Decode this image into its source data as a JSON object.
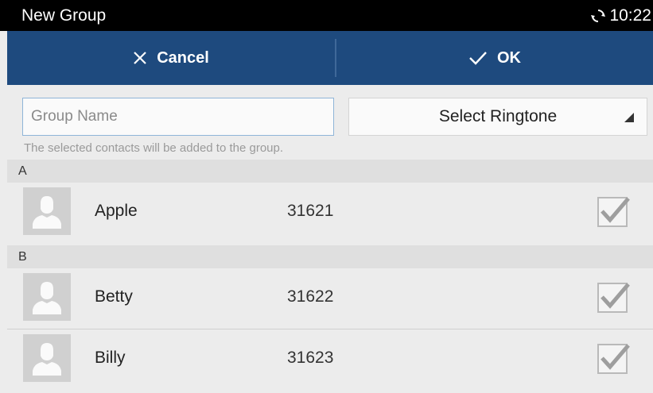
{
  "statusbar": {
    "title": "New Group",
    "time": "10:22"
  },
  "actionbar": {
    "cancel_label": "Cancel",
    "ok_label": "OK"
  },
  "form": {
    "group_name_placeholder": "Group Name",
    "group_name_value": "",
    "ringtone_label": "Select Ringtone",
    "hint": "The selected contacts will be added to the group."
  },
  "sections": [
    {
      "letter": "A",
      "contacts": [
        {
          "name": "Apple",
          "number": "31621",
          "checked": true
        }
      ]
    },
    {
      "letter": "B",
      "contacts": [
        {
          "name": "Betty",
          "number": "31622",
          "checked": true
        },
        {
          "name": "Billy",
          "number": "31623",
          "checked": true
        }
      ]
    }
  ],
  "colors": {
    "actionbar": "#1e4a7e",
    "statusbar": "#000000",
    "background": "#ececec"
  }
}
